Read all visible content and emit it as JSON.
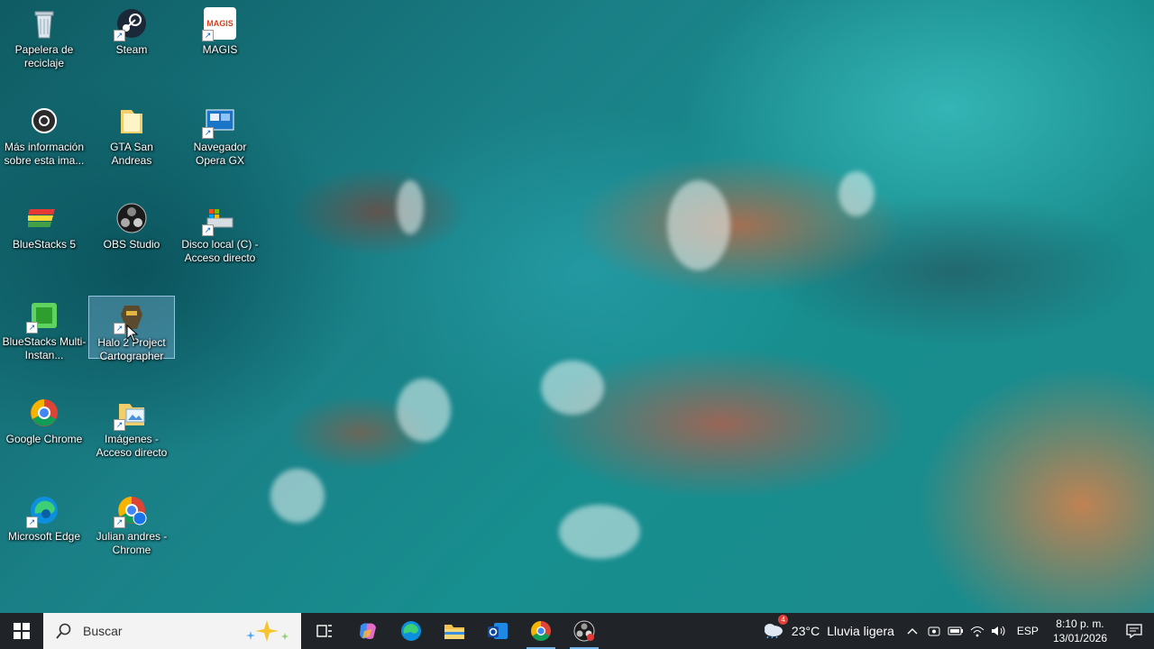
{
  "desktop": {
    "icons": [
      {
        "label": "Papelera de reciclaje",
        "icon": "recycle-bin-icon"
      },
      {
        "label": "Steam",
        "icon": "steam-icon"
      },
      {
        "label": "MAGIS",
        "icon": "magis-icon",
        "logo_text": "MAGIS"
      },
      {
        "label": "Más información sobre esta ima...",
        "icon": "info-camera-icon"
      },
      {
        "label": "GTA San Andreas",
        "icon": "folder-icon"
      },
      {
        "label": "Navegador Opera GX",
        "icon": "opera-gx-icon"
      },
      {
        "label": "BlueStacks 5",
        "icon": "bluestacks-icon"
      },
      {
        "label": "OBS Studio",
        "icon": "obs-icon"
      },
      {
        "label": "Disco local (C) - Acceso directo",
        "icon": "drive-icon"
      },
      {
        "label": "BlueStacks Multi-Instan...",
        "icon": "bluestacks-multi-icon"
      },
      {
        "label": "Halo 2 Project Cartographer",
        "icon": "halo-icon"
      },
      {
        "label": "Google Chrome",
        "icon": "chrome-icon"
      },
      {
        "label": "Imágenes - Acceso directo",
        "icon": "pictures-folder-icon"
      },
      {
        "label": "Microsoft Edge",
        "icon": "edge-icon"
      },
      {
        "label": "Julian andres - Chrome",
        "icon": "chrome-profile-icon"
      }
    ]
  },
  "taskbar": {
    "search_placeholder": "Buscar",
    "apps": [
      "task-view-icon",
      "copilot-icon",
      "edge-icon",
      "file-explorer-icon",
      "outlook-icon",
      "chrome-icon",
      "obs-icon"
    ],
    "weather": {
      "temp": "23°C",
      "condition": "Lluvia ligera",
      "badge": "4"
    },
    "language": "ESP",
    "time": "8:10 p. m.",
    "date": "13/01/2026",
    "accent": "#76b9ed"
  }
}
